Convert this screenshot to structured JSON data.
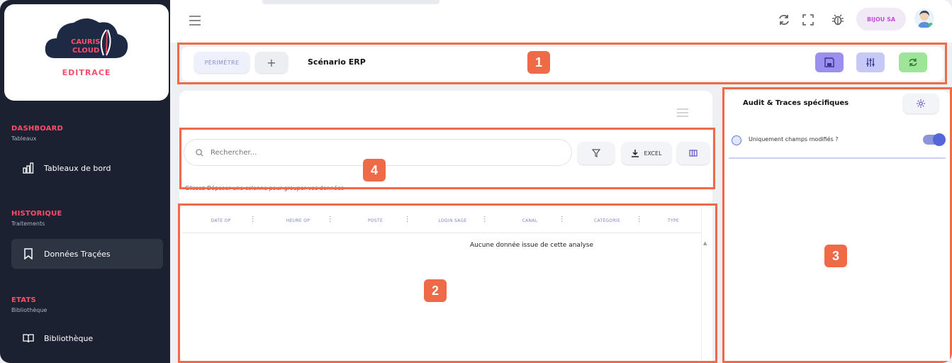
{
  "sidebar": {
    "logo": {
      "line1": "CAURIS",
      "line2": "CLOUD",
      "caption": "EDITRACE"
    },
    "sections": [
      {
        "title": "DASHBOARD",
        "subtitle": "Tableaux",
        "item": "Tableaux de bord"
      },
      {
        "title": "HISTORIQUE",
        "subtitle": "Traitements",
        "item": "Données Traçées"
      },
      {
        "title": "ETATS",
        "subtitle": "Bibliothèque",
        "item": "Bibliothèque"
      }
    ]
  },
  "topbar": {
    "user": "BIJOU SA"
  },
  "toolbar": {
    "perimetre": "PÉRIMÈTRE",
    "plus": "+",
    "scenario": "Scénario ERP"
  },
  "search": {
    "placeholder": "Rechercher...",
    "excel": "EXCEL"
  },
  "grid": {
    "group_hint": "Glissez-Déposer une colonne pour grouper vos données",
    "columns": [
      "DATE OP",
      "HEURE OP",
      "POSTE",
      "LOGIN SAGE",
      "CANAL",
      "CATÉGORIE",
      "TYPE"
    ],
    "empty": "Aucune donnée issue de cette analyse"
  },
  "right_panel": {
    "title": "Audit & Traces spécifiques",
    "option": "Uniquement champs modifiés ?"
  },
  "badges": [
    "1",
    "2",
    "3",
    "4"
  ],
  "colors": {
    "annotation": "#ef6a47",
    "sidebar": "#1b2130",
    "accent_red": "#ff4d6a",
    "save": "#9b8ff0",
    "filter": "#c6c9f5",
    "refresh": "#9ee59a"
  }
}
